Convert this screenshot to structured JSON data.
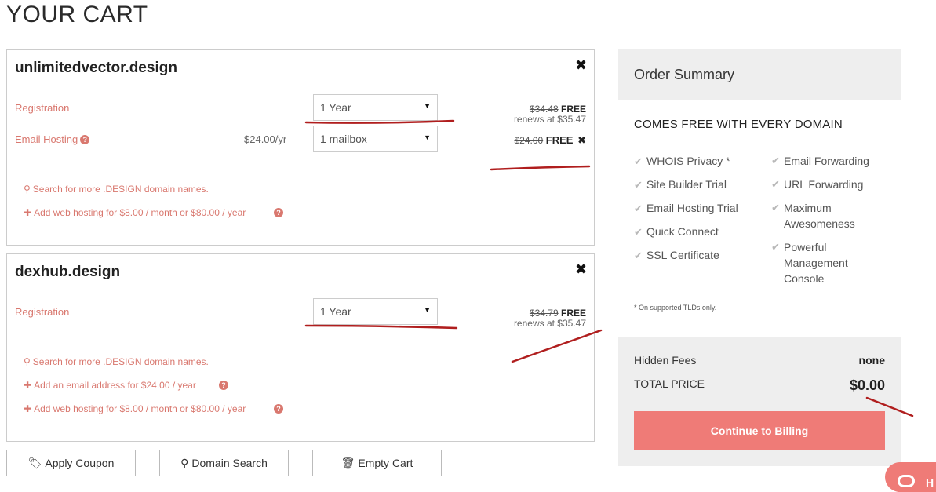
{
  "page_title": "YOUR CART",
  "domains": [
    {
      "name": "unlimitedvector.design",
      "registration_label": "Registration",
      "registration_term": "1 Year",
      "registration_old_price": "$34.48",
      "registration_free": "FREE",
      "registration_renews": "renews at $35.47",
      "email_label": "Email Hosting",
      "email_price": "$24.00/yr",
      "email_option": "1 mailbox",
      "email_old_price": "$24.00",
      "email_free": "FREE",
      "links": [
        {
          "icon": "search-icon",
          "text": "Search for more .DESIGN domain names."
        },
        {
          "icon": "plus-icon",
          "text": "Add web hosting for $8.00 / month or $80.00 / year"
        }
      ]
    },
    {
      "name": "dexhub.design",
      "registration_label": "Registration",
      "registration_term": "1 Year",
      "registration_old_price": "$34.79",
      "registration_free": "FREE",
      "registration_renews": "renews at $35.47",
      "links": [
        {
          "icon": "search-icon",
          "text": "Search for more .DESIGN domain names."
        },
        {
          "icon": "plus-icon",
          "text": "Add an email address for $24.00 / year"
        },
        {
          "icon": "plus-icon",
          "text": "Add web hosting for $8.00 / month or $80.00 / year"
        }
      ]
    }
  ],
  "buttons": {
    "apply_coupon": "Apply Coupon",
    "domain_search": "Domain Search",
    "empty_cart": "Empty Cart"
  },
  "summary": {
    "title": "Order Summary",
    "comes_free": "COMES FREE WITH EVERY DOMAIN",
    "features_left": [
      "WHOIS Privacy *",
      "Site Builder Trial",
      "Email Hosting Trial",
      "Quick Connect",
      "SSL Certificate"
    ],
    "features_right": [
      "Email Forwarding",
      "URL Forwarding",
      "Maximum Awesomeness",
      "Powerful Management Console"
    ],
    "footnote": "* On supported TLDs only.",
    "hidden_fees_label": "Hidden Fees",
    "hidden_fees_value": "none",
    "total_label": "TOTAL PRICE",
    "total_value": "$0.00",
    "continue_label": "Continue to Billing",
    "help_label": "H"
  },
  "colors": {
    "accent": "#ef7b77",
    "link": "#d9786f",
    "panel": "#eeeeee",
    "annotation": "#b01e1e"
  }
}
